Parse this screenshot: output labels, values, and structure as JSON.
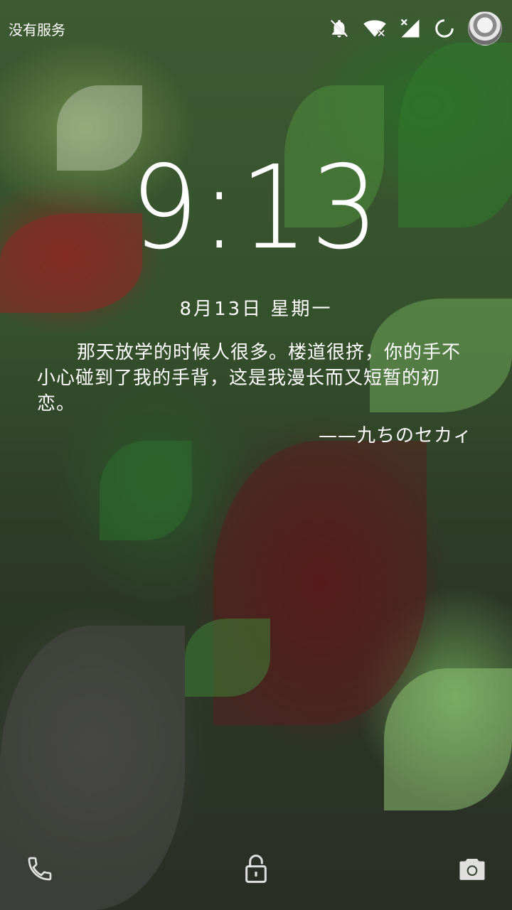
{
  "statusbar": {
    "carrier": "没有服务",
    "icons": [
      "notifications-off-icon",
      "wifi-off-icon",
      "no-signal-icon",
      "loading-ring-icon",
      "avatar"
    ]
  },
  "lockscreen": {
    "time": "9:13",
    "date": "8月13日 星期一",
    "quote": "那天放学的时候人很多。楼道很挤，你的手不小心碰到了我的手背，这是我漫长而又短暂的初恋。",
    "quote_author": "——九ちのセカィ"
  },
  "bottom_bar": {
    "left": "phone-icon",
    "center": "unlock-icon",
    "right": "camera-icon"
  }
}
